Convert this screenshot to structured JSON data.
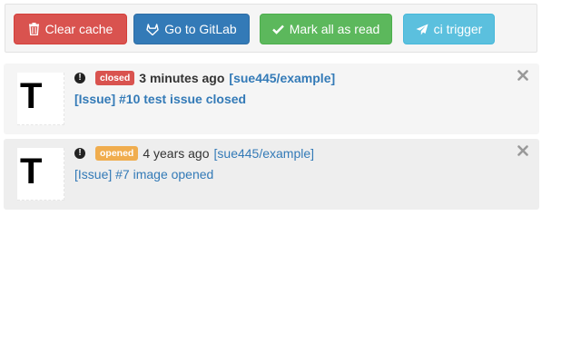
{
  "toolbar": {
    "clear_cache_label": "Clear cache",
    "goto_gitlab_label": "Go to GitLab",
    "mark_all_read_label": "Mark all as read",
    "ci_trigger_label": "ci trigger"
  },
  "notifications": [
    {
      "avatar_letter": "T",
      "status": "closed",
      "time": "3 minutes ago",
      "repo": "[sue445/example]",
      "title": "[Issue] #10 test issue closed"
    },
    {
      "avatar_letter": "T",
      "status": "opened",
      "time": "4 years ago",
      "repo": "[sue445/example]",
      "title": "[Issue] #7 image opened"
    }
  ],
  "colors": {
    "danger": "#d9534f",
    "primary": "#337ab7",
    "success": "#5cb85c",
    "info": "#5bc0de",
    "warning": "#f0ad4e"
  },
  "icons": {
    "clear_cache": "trash-icon",
    "goto_gitlab": "gitlab-icon",
    "mark_all_read": "check-icon",
    "ci_trigger": "paper-plane-icon",
    "notification_state": "exclamation-circle-icon",
    "dismiss": "close-icon"
  }
}
